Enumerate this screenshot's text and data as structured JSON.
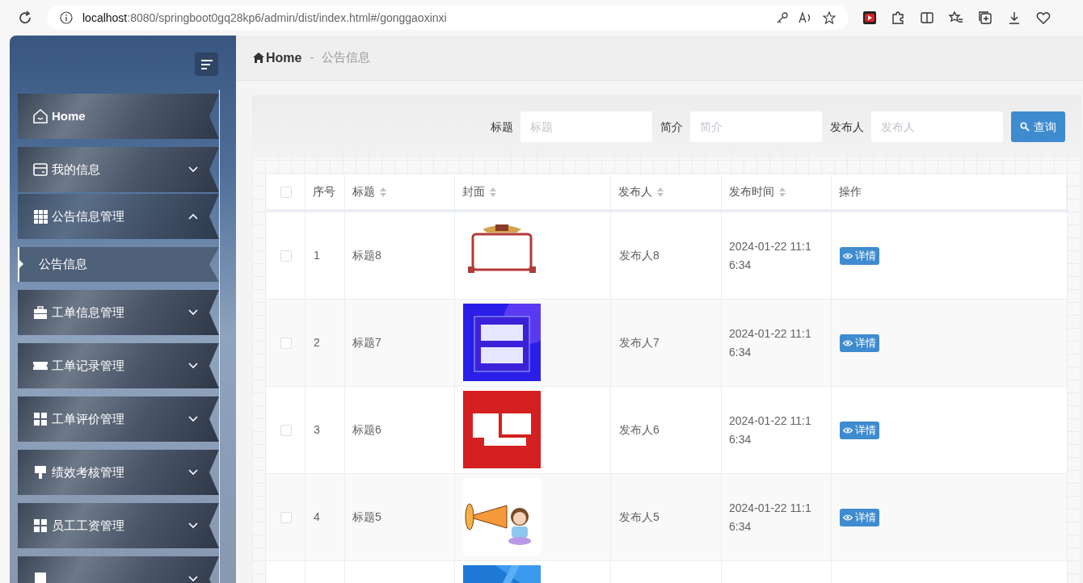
{
  "browser": {
    "url_host": "localhost",
    "url_rest": ":8080/springboot0gq28kp6/admin/dist/index.html#/gonggaoxinxi"
  },
  "sidebar": {
    "items": [
      {
        "label": "Home",
        "kind": "link"
      },
      {
        "label": "我的信息",
        "kind": "menu",
        "expanded": false
      },
      {
        "label": "公告信息管理",
        "kind": "menu",
        "expanded": true,
        "children": [
          {
            "label": "公告信息",
            "selected": true
          }
        ]
      },
      {
        "label": "工单信息管理",
        "kind": "menu",
        "expanded": false
      },
      {
        "label": "工单记录管理",
        "kind": "menu",
        "expanded": false
      },
      {
        "label": "工单评价管理",
        "kind": "menu",
        "expanded": false
      },
      {
        "label": "绩效考核管理",
        "kind": "menu",
        "expanded": false
      },
      {
        "label": "员工工资管理",
        "kind": "menu",
        "expanded": false
      },
      {
        "kind": "menu",
        "expanded": false
      }
    ]
  },
  "breadcrumb": {
    "home": "Home",
    "separator": "-",
    "current": "公告信息"
  },
  "search": {
    "fields": [
      {
        "label": "标题",
        "placeholder": "标题"
      },
      {
        "label": "简介",
        "placeholder": "简介"
      },
      {
        "label": "发布人",
        "placeholder": "发布人"
      }
    ],
    "button": "查询"
  },
  "table": {
    "select_all": {
      "checked": false
    },
    "columns": [
      {
        "label": "序号",
        "sortable": false
      },
      {
        "label": "标题",
        "sortable": true
      },
      {
        "label": "封面",
        "sortable": true
      },
      {
        "label": "发布人",
        "sortable": true
      },
      {
        "label": "发布时间",
        "sortable": true
      },
      {
        "label": "操作",
        "sortable": false
      }
    ],
    "rows": [
      {
        "checked": false,
        "index": "1",
        "title": "标题8",
        "cover": {
          "kind": "picture"
        },
        "author": "发布人8",
        "time": "2024-01-22 11:16:34",
        "action": "详情"
      },
      {
        "checked": false,
        "index": "2",
        "title": "标题7",
        "cover": {
          "kind": "picture"
        },
        "author": "发布人7",
        "time": "2024-01-22 11:16:34",
        "action": "详情"
      },
      {
        "checked": false,
        "index": "3",
        "title": "标题6",
        "cover": {
          "kind": "picture"
        },
        "author": "发布人6",
        "time": "2024-01-22 11:16:34",
        "action": "详情"
      },
      {
        "checked": false,
        "index": "4",
        "title": "标题5",
        "cover": {
          "kind": "picture"
        },
        "author": "发布人5",
        "time": "2024-01-22 11:16:34",
        "action": "详情"
      },
      {
        "cover": {
          "kind": "picture"
        }
      }
    ]
  }
}
